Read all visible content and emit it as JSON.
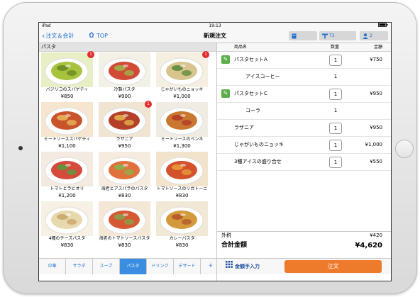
{
  "status_bar": {
    "carrier": "iPad",
    "time": "19:13"
  },
  "nav": {
    "back_label": "注文＆会計",
    "top_label": "TOP",
    "title": "新規注文",
    "table_label": "T3",
    "guest_count": "2"
  },
  "category_header": "パスタ",
  "menu_items": [
    {
      "name": "バジリコのスパゲティ",
      "price": "¥850",
      "badge": "1",
      "colors": [
        "#e9efc5",
        "#a7c23d",
        "#6a8a24"
      ]
    },
    {
      "name": "冷製パスタ",
      "price": "¥900",
      "badge": "",
      "colors": [
        "#f3f0e6",
        "#d14a36",
        "#9cb24c"
      ]
    },
    {
      "name": "じゃがいものニョッキ",
      "price": "¥1,000",
      "badge": "1",
      "colors": [
        "#f4efe0",
        "#d9c48d",
        "#5c8c3c"
      ]
    },
    {
      "name": "ミートソーススパゲティ",
      "price": "¥1,100",
      "badge": "",
      "colors": [
        "#f6e6cf",
        "#c9542b",
        "#e8b35b"
      ]
    },
    {
      "name": "ラザニア",
      "price": "¥950",
      "badge": "1",
      "colors": [
        "#f0e4d2",
        "#b5402a",
        "#e2b04a"
      ]
    },
    {
      "name": "ミートソースのペンネ",
      "price": "¥1,300",
      "badge": "",
      "colors": [
        "#f0ece3",
        "#c9772f",
        "#b23b2a"
      ]
    },
    {
      "name": "トマトとラビオリ",
      "price": "¥1,200",
      "badge": "",
      "colors": [
        "#f3ebe1",
        "#d64a3b",
        "#5c9a3b"
      ]
    },
    {
      "name": "海老とアスパラのパスタ",
      "price": "¥830",
      "badge": "",
      "colors": [
        "#f5ecdf",
        "#e0703c",
        "#8bb04c"
      ]
    },
    {
      "name": "トマトソースのリガトーニ",
      "price": "¥830",
      "badge": "",
      "colors": [
        "#f2e3cc",
        "#d3522b",
        "#e89a3c"
      ]
    },
    {
      "name": "4種のチーズパスタ",
      "price": "¥830",
      "badge": "",
      "colors": [
        "#f6f1e4",
        "#e8d8ae",
        "#c9a86a"
      ]
    },
    {
      "name": "海老のトマトソースパスタ",
      "price": "¥830",
      "badge": "",
      "colors": [
        "#f4e7d6",
        "#d55a34",
        "#8a9f4b"
      ]
    },
    {
      "name": "カレーパスタ",
      "price": "¥830",
      "badge": "",
      "colors": [
        "#f2e8d6",
        "#d39a3b",
        "#b7572c"
      ]
    }
  ],
  "category_tabs": [
    {
      "label": "中華",
      "active": false
    },
    {
      "label": "サラダ",
      "active": false
    },
    {
      "label": "スープ",
      "active": false
    },
    {
      "label": "パスタ",
      "active": true
    },
    {
      "label": "ドリンク",
      "active": false
    },
    {
      "label": "デザート",
      "active": false
    },
    {
      "label": "そ",
      "active": false
    }
  ],
  "order_table": {
    "col_name": "商品名",
    "col_qty": "数量",
    "col_amount": "金額",
    "rows": [
      {
        "name": "パスタセットA",
        "qty": "1",
        "amount": "¥750",
        "editable": true,
        "sub": false,
        "qty_box": true
      },
      {
        "name": "アイスコーヒー",
        "qty": "1",
        "amount": "",
        "editable": false,
        "sub": true,
        "qty_box": false
      },
      {
        "name": "パスタセットC",
        "qty": "1",
        "amount": "¥950",
        "editable": true,
        "sub": false,
        "qty_box": true
      },
      {
        "name": "コーラ",
        "qty": "1",
        "amount": "",
        "editable": false,
        "sub": true,
        "qty_box": false
      },
      {
        "name": "ラザニア",
        "qty": "1",
        "amount": "¥950",
        "editable": false,
        "sub": false,
        "qty_box": true
      },
      {
        "name": "じゃがいものニョッキ",
        "qty": "1",
        "amount": "¥1,000",
        "editable": false,
        "sub": false,
        "qty_box": true
      },
      {
        "name": "3種アイスの盛り合せ",
        "qty": "1",
        "amount": "¥550",
        "editable": false,
        "sub": false,
        "qty_box": true
      }
    ]
  },
  "tax": {
    "label": "外税",
    "value": "¥420"
  },
  "total": {
    "label": "合計金額",
    "value": "¥4,620"
  },
  "actions": {
    "keypad_label": "金額手入力",
    "order_label": "注文"
  },
  "theme": {
    "accent": "#1f6fd1",
    "order_button": "#ee7a2b",
    "badge": "#e32b2b",
    "edit_icon": "#5cae4b"
  }
}
